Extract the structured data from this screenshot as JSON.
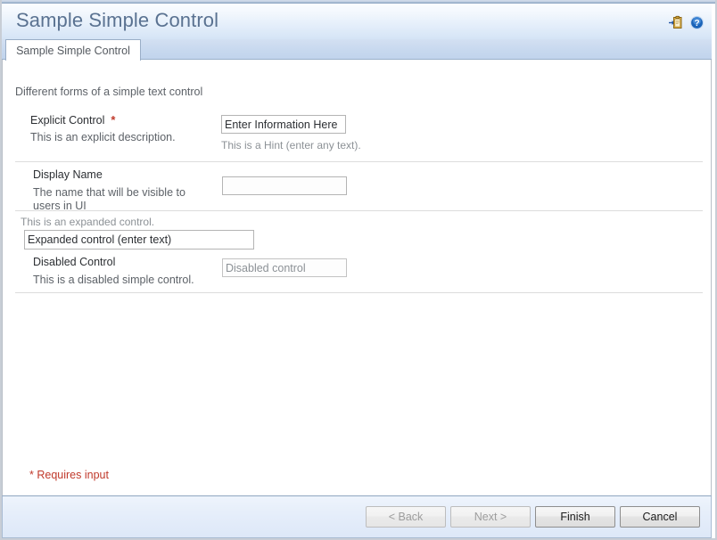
{
  "window": {
    "title": "Sample Simple Control",
    "accent_color": "#5a7291",
    "required_color": "#c0392b"
  },
  "header": {
    "title": "Sample Simple Control",
    "icons": [
      {
        "name": "paste-clipboard-icon",
        "label": "Paste"
      },
      {
        "name": "help-icon",
        "label": "Help"
      }
    ]
  },
  "tabs": [
    {
      "label": "Sample Simple Control",
      "selected": true
    }
  ],
  "main": {
    "intro": "Different forms of a simple text control",
    "rows": [
      {
        "label": "Explicit Control",
        "required": true,
        "required_marker": "*",
        "description": "This is an explicit description.",
        "input_value": "Enter Information Here",
        "input_placeholder": "",
        "hint": "This is a Hint (enter any text).",
        "disabled": false
      },
      {
        "label": "Display Name",
        "required": false,
        "required_marker": "",
        "description": "The name that will be visible to users in UI",
        "input_value": "",
        "input_placeholder": "",
        "hint": "",
        "disabled": false
      },
      {
        "label": "",
        "required": false,
        "required_marker": "",
        "description": "",
        "expanded_note": "This is an expanded control.",
        "input_value": "Expanded control (enter text)",
        "input_placeholder": "",
        "hint": "",
        "disabled": false
      },
      {
        "label": "Disabled Control",
        "required": false,
        "required_marker": "",
        "description": "This is a disabled simple control.",
        "input_value": "Disabled control",
        "input_placeholder": "",
        "hint": "",
        "disabled": true
      }
    ],
    "requires_input_note": "* Requires input"
  },
  "footer": {
    "buttons": [
      {
        "label": "< Back",
        "name": "back-button",
        "disabled": true
      },
      {
        "label": "Next >",
        "name": "next-button",
        "disabled": true
      },
      {
        "label": "Finish",
        "name": "finish-button",
        "disabled": false
      },
      {
        "label": "Cancel",
        "name": "cancel-button",
        "disabled": false
      }
    ]
  }
}
